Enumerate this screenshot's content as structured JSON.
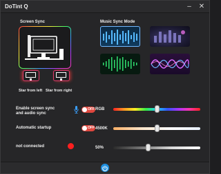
{
  "window": {
    "title": "DoTint Q",
    "minimize_glyph": "–",
    "close_glyph": "✕"
  },
  "screen_sync": {
    "heading": "Screen Sync",
    "left_caption": "Star from left",
    "right_caption": "Star from right"
  },
  "music_sync": {
    "heading": "Music Sync Mode",
    "modes": [
      "waveform-bars",
      "equalizer-photo",
      "green-wave",
      "purple-wave"
    ]
  },
  "settings": {
    "enable_sync_label_line1": "Enable screen sync",
    "enable_sync_label_line2": "and audio sync",
    "enable_sync_state": "OFF",
    "auto_startup_label": "Automatic startup",
    "auto_startup_state": "OFF",
    "connection_status": "not connected"
  },
  "sliders": {
    "rgb_label": "RGB",
    "rgb_position": 0.5,
    "kelvin_label": "4500K",
    "kelvin_position": 0.5,
    "brightness_label": "50%",
    "brightness_position": 0.4
  },
  "colors": {
    "toggle_off": "#e0473e",
    "status_disconnected": "#ff1f1f",
    "power_button": "#1e8fe0",
    "selected_tile_border": "#6fb7ff"
  },
  "icons": [
    "minimize-icon",
    "close-icon",
    "monitor-icon",
    "microphone-icon",
    "power-icon"
  ]
}
